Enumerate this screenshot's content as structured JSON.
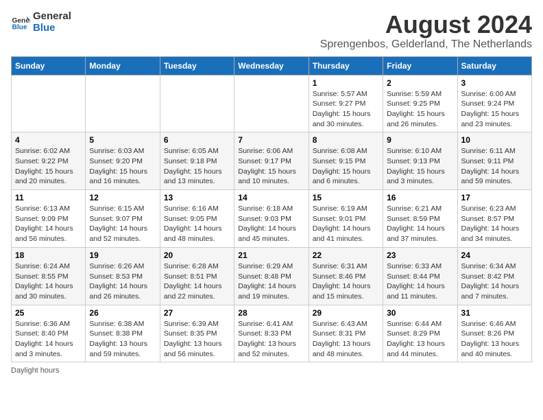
{
  "header": {
    "logo_general": "General",
    "logo_blue": "Blue",
    "month_title": "August 2024",
    "location": "Sprengenbos, Gelderland, The Netherlands"
  },
  "days_of_week": [
    "Sunday",
    "Monday",
    "Tuesday",
    "Wednesday",
    "Thursday",
    "Friday",
    "Saturday"
  ],
  "weeks": [
    [
      {
        "day": "",
        "info": ""
      },
      {
        "day": "",
        "info": ""
      },
      {
        "day": "",
        "info": ""
      },
      {
        "day": "",
        "info": ""
      },
      {
        "day": "1",
        "info": "Sunrise: 5:57 AM\nSunset: 9:27 PM\nDaylight: 15 hours\nand 30 minutes."
      },
      {
        "day": "2",
        "info": "Sunrise: 5:59 AM\nSunset: 9:25 PM\nDaylight: 15 hours\nand 26 minutes."
      },
      {
        "day": "3",
        "info": "Sunrise: 6:00 AM\nSunset: 9:24 PM\nDaylight: 15 hours\nand 23 minutes."
      }
    ],
    [
      {
        "day": "4",
        "info": "Sunrise: 6:02 AM\nSunset: 9:22 PM\nDaylight: 15 hours\nand 20 minutes."
      },
      {
        "day": "5",
        "info": "Sunrise: 6:03 AM\nSunset: 9:20 PM\nDaylight: 15 hours\nand 16 minutes."
      },
      {
        "day": "6",
        "info": "Sunrise: 6:05 AM\nSunset: 9:18 PM\nDaylight: 15 hours\nand 13 minutes."
      },
      {
        "day": "7",
        "info": "Sunrise: 6:06 AM\nSunset: 9:17 PM\nDaylight: 15 hours\nand 10 minutes."
      },
      {
        "day": "8",
        "info": "Sunrise: 6:08 AM\nSunset: 9:15 PM\nDaylight: 15 hours\nand 6 minutes."
      },
      {
        "day": "9",
        "info": "Sunrise: 6:10 AM\nSunset: 9:13 PM\nDaylight: 15 hours\nand 3 minutes."
      },
      {
        "day": "10",
        "info": "Sunrise: 6:11 AM\nSunset: 9:11 PM\nDaylight: 14 hours\nand 59 minutes."
      }
    ],
    [
      {
        "day": "11",
        "info": "Sunrise: 6:13 AM\nSunset: 9:09 PM\nDaylight: 14 hours\nand 56 minutes."
      },
      {
        "day": "12",
        "info": "Sunrise: 6:15 AM\nSunset: 9:07 PM\nDaylight: 14 hours\nand 52 minutes."
      },
      {
        "day": "13",
        "info": "Sunrise: 6:16 AM\nSunset: 9:05 PM\nDaylight: 14 hours\nand 48 minutes."
      },
      {
        "day": "14",
        "info": "Sunrise: 6:18 AM\nSunset: 9:03 PM\nDaylight: 14 hours\nand 45 minutes."
      },
      {
        "day": "15",
        "info": "Sunrise: 6:19 AM\nSunset: 9:01 PM\nDaylight: 14 hours\nand 41 minutes."
      },
      {
        "day": "16",
        "info": "Sunrise: 6:21 AM\nSunset: 8:59 PM\nDaylight: 14 hours\nand 37 minutes."
      },
      {
        "day": "17",
        "info": "Sunrise: 6:23 AM\nSunset: 8:57 PM\nDaylight: 14 hours\nand 34 minutes."
      }
    ],
    [
      {
        "day": "18",
        "info": "Sunrise: 6:24 AM\nSunset: 8:55 PM\nDaylight: 14 hours\nand 30 minutes."
      },
      {
        "day": "19",
        "info": "Sunrise: 6:26 AM\nSunset: 8:53 PM\nDaylight: 14 hours\nand 26 minutes."
      },
      {
        "day": "20",
        "info": "Sunrise: 6:28 AM\nSunset: 8:51 PM\nDaylight: 14 hours\nand 22 minutes."
      },
      {
        "day": "21",
        "info": "Sunrise: 6:29 AM\nSunset: 8:48 PM\nDaylight: 14 hours\nand 19 minutes."
      },
      {
        "day": "22",
        "info": "Sunrise: 6:31 AM\nSunset: 8:46 PM\nDaylight: 14 hours\nand 15 minutes."
      },
      {
        "day": "23",
        "info": "Sunrise: 6:33 AM\nSunset: 8:44 PM\nDaylight: 14 hours\nand 11 minutes."
      },
      {
        "day": "24",
        "info": "Sunrise: 6:34 AM\nSunset: 8:42 PM\nDaylight: 14 hours\nand 7 minutes."
      }
    ],
    [
      {
        "day": "25",
        "info": "Sunrise: 6:36 AM\nSunset: 8:40 PM\nDaylight: 14 hours\nand 3 minutes."
      },
      {
        "day": "26",
        "info": "Sunrise: 6:38 AM\nSunset: 8:38 PM\nDaylight: 13 hours\nand 59 minutes."
      },
      {
        "day": "27",
        "info": "Sunrise: 6:39 AM\nSunset: 8:35 PM\nDaylight: 13 hours\nand 56 minutes."
      },
      {
        "day": "28",
        "info": "Sunrise: 6:41 AM\nSunset: 8:33 PM\nDaylight: 13 hours\nand 52 minutes."
      },
      {
        "day": "29",
        "info": "Sunrise: 6:43 AM\nSunset: 8:31 PM\nDaylight: 13 hours\nand 48 minutes."
      },
      {
        "day": "30",
        "info": "Sunrise: 6:44 AM\nSunset: 8:29 PM\nDaylight: 13 hours\nand 44 minutes."
      },
      {
        "day": "31",
        "info": "Sunrise: 6:46 AM\nSunset: 8:26 PM\nDaylight: 13 hours\nand 40 minutes."
      }
    ]
  ],
  "footer": {
    "note": "Daylight hours"
  }
}
